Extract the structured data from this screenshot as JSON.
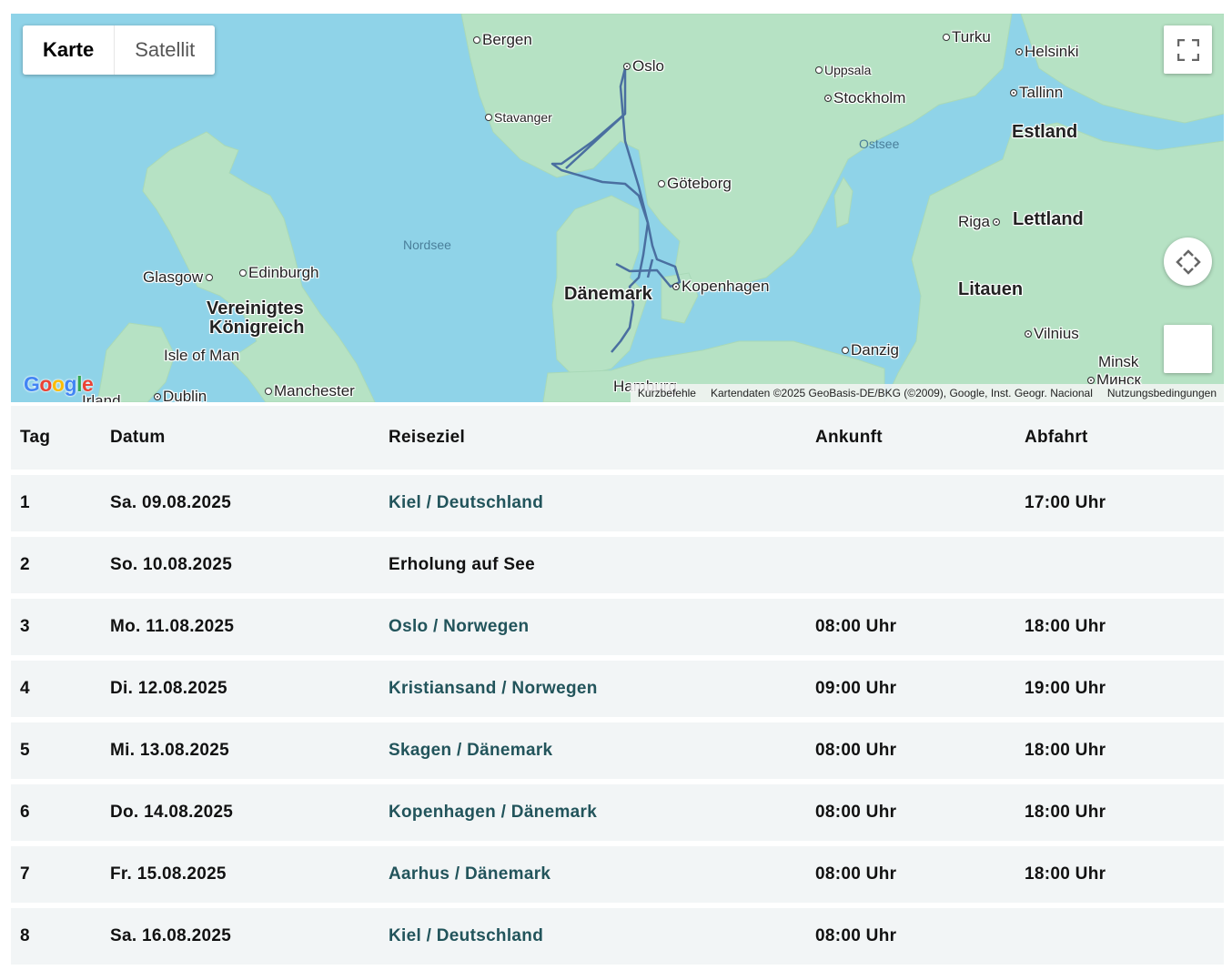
{
  "map": {
    "type_buttons": [
      "Karte",
      "Satellit"
    ],
    "active_type": "Karte",
    "logo": "Google",
    "labels": {
      "bergen": "Bergen",
      "oslo": "Oslo",
      "turku": "Turku",
      "helsinki": "Helsinki",
      "uppsala": "Uppsala",
      "stockholm": "Stockholm",
      "tallinn": "Tallinn",
      "stavanger": "Stavanger",
      "ostsee": "Ostsee",
      "estland": "Estland",
      "goteborg": "Göteborg",
      "riga": "Riga",
      "lettland": "Lettland",
      "nordsee": "Nordsee",
      "glasgow": "Glasgow",
      "edinburgh": "Edinburgh",
      "kopenhagen": "Kopenhagen",
      "danemark": "Dänemark",
      "litauen": "Litauen",
      "vereinigtes": "Vereinigtes",
      "konigreich": "Königreich",
      "vilnius": "Vilnius",
      "isleofman": "Isle of Man",
      "danzig": "Danzig",
      "minsk": "Minsk",
      "minsk_ru": "Минск",
      "dublin": "Dublin",
      "manchester": "Manchester",
      "hamburg": "Hamburg",
      "irland": "Irland"
    },
    "attribution": {
      "shortcuts": "Kurzbefehle",
      "data": "Kartendaten ©2025 GeoBasis-DE/BKG (©2009), Google, Inst. Geogr. Nacional",
      "terms": "Nutzungsbedingungen"
    },
    "colors": {
      "water": "#8fd3e8",
      "land": "#b6e2c4",
      "route": "#4a6fa0"
    }
  },
  "itinerary": {
    "headers": {
      "day": "Tag",
      "date": "Datum",
      "destination": "Reiseziel",
      "arrival": "Ankunft",
      "departure": "Abfahrt"
    },
    "rows": [
      {
        "day": "1",
        "date": "Sa. 09.08.2025",
        "destination": "Kiel / Deutschland",
        "arrival": "",
        "departure": "17:00 Uhr",
        "link": true
      },
      {
        "day": "2",
        "date": "So. 10.08.2025",
        "destination": "Erholung auf See",
        "arrival": "",
        "departure": "",
        "link": false
      },
      {
        "day": "3",
        "date": "Mo. 11.08.2025",
        "destination": "Oslo / Norwegen",
        "arrival": "08:00 Uhr",
        "departure": "18:00 Uhr",
        "link": true
      },
      {
        "day": "4",
        "date": "Di. 12.08.2025",
        "destination": "Kristiansand / Norwegen",
        "arrival": "09:00 Uhr",
        "departure": "19:00 Uhr",
        "link": true
      },
      {
        "day": "5",
        "date": "Mi. 13.08.2025",
        "destination": "Skagen / Dänemark",
        "arrival": "08:00 Uhr",
        "departure": "18:00 Uhr",
        "link": true
      },
      {
        "day": "6",
        "date": "Do. 14.08.2025",
        "destination": "Kopenhagen / Dänemark",
        "arrival": "08:00 Uhr",
        "departure": "18:00 Uhr",
        "link": true
      },
      {
        "day": "7",
        "date": "Fr. 15.08.2025",
        "destination": "Aarhus / Dänemark",
        "arrival": "08:00 Uhr",
        "departure": "18:00 Uhr",
        "link": true
      },
      {
        "day": "8",
        "date": "Sa. 16.08.2025",
        "destination": "Kiel / Deutschland",
        "arrival": "08:00 Uhr",
        "departure": "",
        "link": true
      }
    ],
    "colors": {
      "row_bg": "#f2f5f6",
      "link": "#22545b"
    }
  }
}
